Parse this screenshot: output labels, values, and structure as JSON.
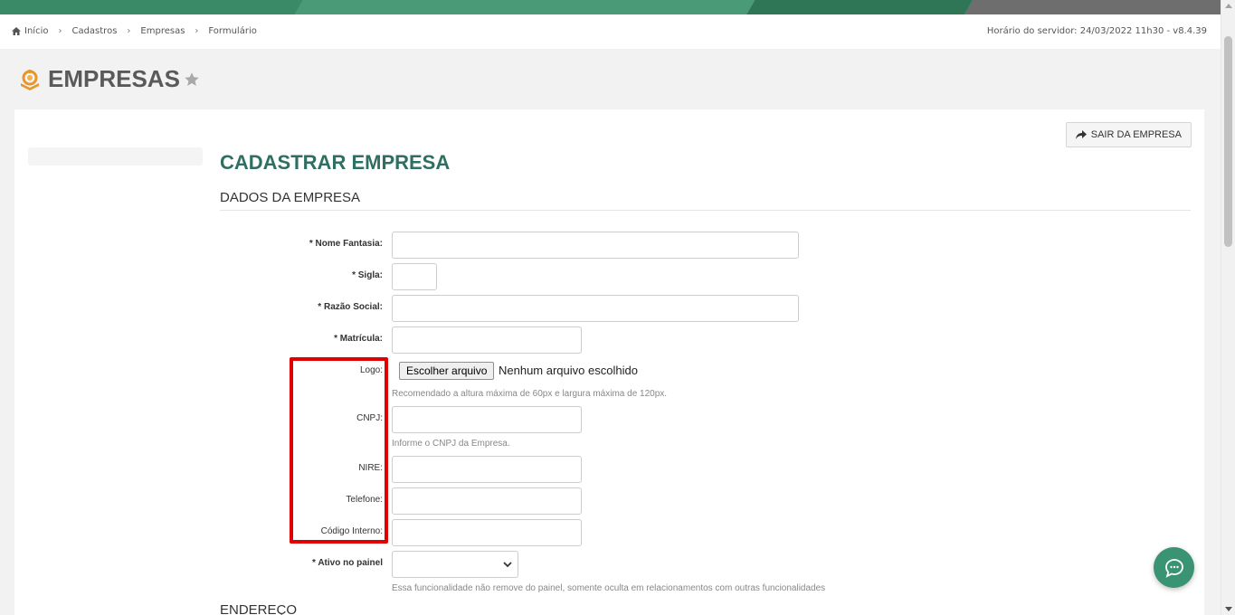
{
  "breadcrumb": {
    "items": [
      "Início",
      "Cadastros",
      "Empresas",
      "Formulário"
    ]
  },
  "server_time": "Horário do servidor: 24/03/2022 11h30 - v8.4.39",
  "page": {
    "title": "EMPRESAS"
  },
  "toolbar": {
    "exit_label": "SAIR DA EMPRESA"
  },
  "form": {
    "title": "CADASTRAR EMPRESA",
    "section_company": "DADOS DA EMPRESA",
    "section_address": "ENDEREÇO",
    "fields": {
      "nome_fantasia": "* Nome Fantasia:",
      "sigla": "* Sigla:",
      "razao_social": "* Razão Social:",
      "matricula": "* Matrícula:",
      "logo": "Logo:",
      "cnpj": "CNPJ:",
      "nire": "NIRE:",
      "telefone": "Telefone:",
      "codigo_interno": "Código Interno:",
      "ativo_painel": "* Ativo no painel"
    },
    "file": {
      "button_label": "Escolher arquivo",
      "status": "Nenhum arquivo escolhido"
    },
    "help": {
      "logo": "Recomendado a altura máxima de 60px e largura máxima de 120px.",
      "cnpj": "Informe o CNPJ da Empresa.",
      "ativo": "Essa funcionalidade não remove do painel, somente oculta em relacionamentos com outras funcionalidades"
    }
  },
  "colors": {
    "brand_green": "#3a8a68",
    "title_teal": "#2f6f62",
    "highlight_red": "#e00000"
  }
}
